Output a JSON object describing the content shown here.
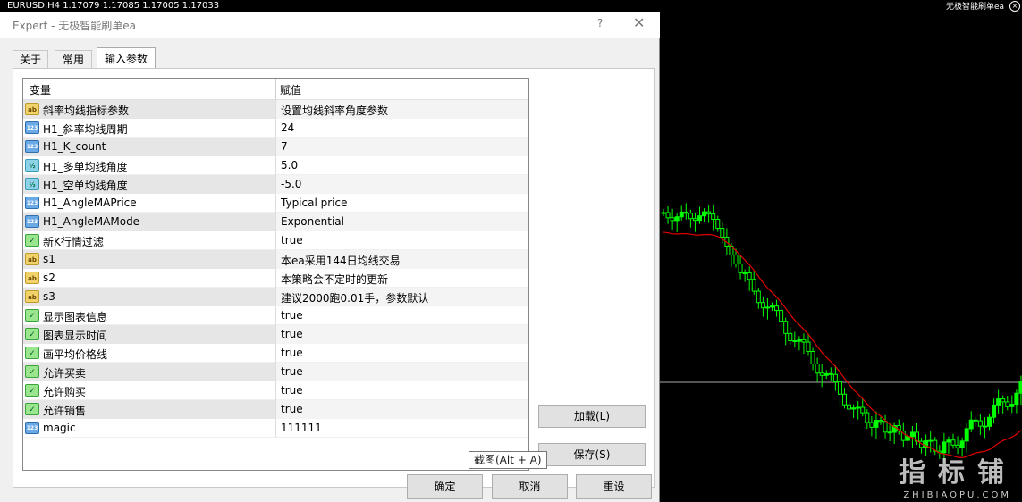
{
  "chart": {
    "symbol_bar": "EURUSD,H4  1.17079 1.17085 1.17005 1.17033",
    "ea_name": "无极智能刷单ea",
    "close_glyph": "×",
    "watermark": "指标铺",
    "watermark_sub": "ZHIBIAOPU.COM",
    "colors": {
      "background": "#000000",
      "bull": "#00ff00",
      "bear": "#000000",
      "ma": "#e00000",
      "level": "#aaaaaa"
    }
  },
  "dialog": {
    "title": "Expert - 无极智能刷单ea",
    "help_glyph": "?",
    "close_glyph": "✕",
    "tabs": [
      "关于",
      "常用",
      "输入参数"
    ],
    "active_tab": "输入参数",
    "grid": {
      "col_variable": "变量",
      "col_value": "赋值",
      "rows": [
        {
          "type": "ab",
          "icon": "ab",
          "name": "斜率均线指标参数",
          "value": "设置均线斜率角度参数"
        },
        {
          "type": "123",
          "icon": "123",
          "name": "H1_斜率均线周期",
          "value": "24"
        },
        {
          "type": "123",
          "icon": "123",
          "name": "H1_K_count",
          "value": "7"
        },
        {
          "type": "half",
          "icon": "½",
          "name": "H1_多单均线角度",
          "value": "5.0"
        },
        {
          "type": "half",
          "icon": "½",
          "name": "H1_空单均线角度",
          "value": "-5.0"
        },
        {
          "type": "123",
          "icon": "123",
          "name": "H1_AngleMAPrice",
          "value": "Typical price"
        },
        {
          "type": "123",
          "icon": "123",
          "name": "H1_AngleMAMode",
          "value": "Exponential"
        },
        {
          "type": "bool",
          "icon": "✓",
          "name": "新K行情过滤",
          "value": "true"
        },
        {
          "type": "ab",
          "icon": "ab",
          "name": "s1",
          "value": "本ea采用144日均线交易"
        },
        {
          "type": "ab",
          "icon": "ab",
          "name": "s2",
          "value": "本策略会不定时的更新"
        },
        {
          "type": "ab",
          "icon": "ab",
          "name": "s3",
          "value": "建议2000跑0.01手，参数默认"
        },
        {
          "type": "bool",
          "icon": "✓",
          "name": "显示图表信息",
          "value": "true"
        },
        {
          "type": "bool",
          "icon": "✓",
          "name": "图表显示时间",
          "value": "true"
        },
        {
          "type": "bool",
          "icon": "✓",
          "name": "画平均价格线",
          "value": "true"
        },
        {
          "type": "bool",
          "icon": "✓",
          "name": "允许买卖",
          "value": "true"
        },
        {
          "type": "bool",
          "icon": "✓",
          "name": "允许购买",
          "value": "true"
        },
        {
          "type": "bool",
          "icon": "✓",
          "name": "允许销售",
          "value": "true"
        },
        {
          "type": "123",
          "icon": "123",
          "name": "magic",
          "value": "111111"
        }
      ]
    },
    "buttons": {
      "load": "加载(L)",
      "save": "保存(S)",
      "ok": "确定",
      "cancel": "取消",
      "reset": "重设"
    },
    "tooltip": "截图(Alt + A)"
  }
}
